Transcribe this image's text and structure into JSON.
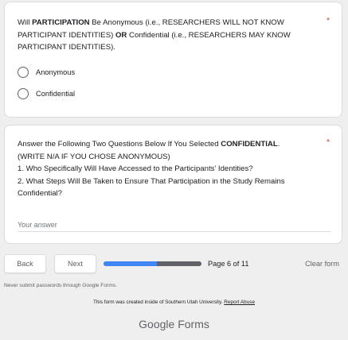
{
  "question1": {
    "title_parts": [
      {
        "text": "Will ",
        "bold": false
      },
      {
        "text": "PARTICIPATION",
        "bold": true
      },
      {
        "text": " Be Anonymous (i.e., RESEARCHERS WILL NOT KNOW PARTICIPANT IDENTITIES) ",
        "bold": false
      },
      {
        "text": "OR",
        "bold": true
      },
      {
        "text": " Confidential (i.e., RESEARCHERS MAY KNOW PARTICIPANT IDENTITIES).",
        "bold": false
      }
    ],
    "required_mark": "*",
    "options": [
      "Anonymous",
      "Confidential"
    ]
  },
  "question2": {
    "line1_prefix": "Answer the Following Two Questions Below If You Selected ",
    "line1_bold": "CONFIDENTIAL",
    "line1_suffix": ".",
    "line2": "(WRITE N/A IF YOU CHOSE ANONYMOUS)",
    "line3": "1. Who Specifically Will Have Accessed to the Participants' Identities?",
    "line4": "2. What Steps Will Be Taken to Ensure That Participation in the Study Remains Confidential?",
    "required_mark": "*",
    "answer_placeholder": "Your answer"
  },
  "navigation": {
    "back_label": "Back",
    "next_label": "Next",
    "progress_fraction": 0.545,
    "page_text": "Page 6 of 11",
    "clear_label": "Clear form"
  },
  "footer": {
    "password_note": "Never submit passwords through Google Forms.",
    "created_text": "This form was created inside of Southern Utah University.",
    "report_label": "Report Abuse",
    "brand_google": "Google",
    "brand_forms": "Forms"
  },
  "colors": {
    "progress_fill": "#4285f4",
    "progress_track": "#5f6368",
    "required": "#d93025"
  }
}
